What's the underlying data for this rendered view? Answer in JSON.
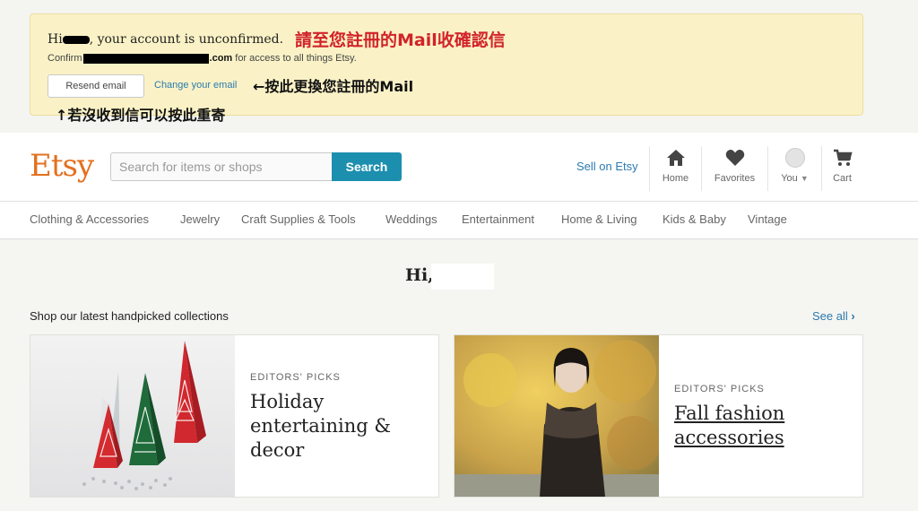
{
  "notice": {
    "hi": "Hi",
    "line1_rest": ", your account is unconfirmed.",
    "annotation_red": "請至您註冊的Mail收確認信",
    "confirm_prefix": "Confirm",
    "confirm_domain": ".com",
    "confirm_suffix": " for access to all things Etsy.",
    "resend_label": "Resend email",
    "change_label": "Change your email",
    "annotation_change": "←按此更換您註冊的Mail",
    "annotation_resend": "↑若沒收到信可以按此重寄"
  },
  "header": {
    "logo": "Etsy",
    "search_placeholder": "Search for items or shops",
    "search_label": "Search",
    "sell_label": "Sell on Etsy",
    "home_label": "Home",
    "favorites_label": "Favorites",
    "you_label": "You",
    "cart_label": "Cart"
  },
  "categories": [
    "Clothing & Accessories",
    "Jewelry",
    "Craft Supplies & Tools",
    "Weddings",
    "Entertainment",
    "Home & Living",
    "Kids & Baby",
    "Vintage"
  ],
  "main": {
    "greeting": "Hi,",
    "collections_label": "Shop our latest handpicked collections",
    "see_all_label": "See all",
    "cards": [
      {
        "kicker": "EDITORS' PICKS",
        "title_lines": [
          "Holiday",
          "entertaining &",
          "decor"
        ]
      },
      {
        "kicker": "EDITORS' PICKS",
        "title_lines": [
          "Fall fashion",
          "accessories"
        ]
      }
    ]
  },
  "colors": {
    "brand": "#e3701e",
    "search": "#1d8fae",
    "link": "#2b7bb0",
    "notice_bg": "#faf2c6",
    "annotation_red": "#d2232a"
  },
  "icons": [
    "home-icon",
    "heart-icon",
    "avatar",
    "chevron-down-icon",
    "cart-icon",
    "chevron-right-icon"
  ]
}
